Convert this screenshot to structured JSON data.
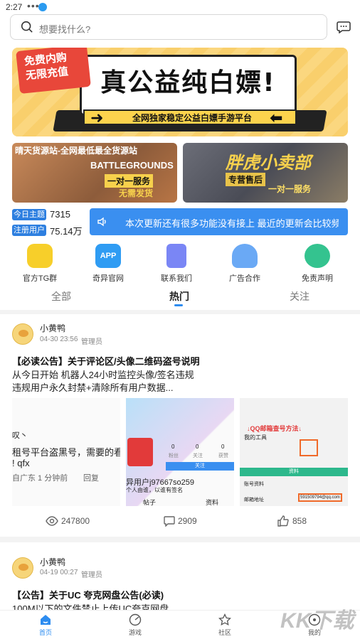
{
  "status": {
    "time": "2:27",
    "dots": "•••"
  },
  "search": {
    "placeholder": "想要找什么?"
  },
  "banner": {
    "badge": "免费内购\n无限充值",
    "headline": "真公益纯白嫖!",
    "subtitle": "全网独家稳定公益白嫖手游平台"
  },
  "small_banners": [
    {
      "line1": "晴天货源站-全网最低最全货源站",
      "line2": "BATTLEGROUNDS",
      "line3": "一对一服务",
      "line4": "无需发货"
    },
    {
      "line1": "",
      "line2": "胖虎小卖部",
      "line3": "专营售后",
      "line4": "一对一服务"
    }
  ],
  "stats": {
    "topics_label": "今日主题",
    "topics_value": "7315",
    "users_label": "注册用户",
    "users_value": "75.14万"
  },
  "notice": {
    "text": "本次更新还有很多功能没有接上 最近的更新会比较频繁"
  },
  "quick_icons": [
    {
      "label": "官方TG群",
      "color": "#f7cf2a"
    },
    {
      "label": "奇异官网",
      "color": "#2f9cf3"
    },
    {
      "label": "联系我们",
      "color": "#7a86f5"
    },
    {
      "label": "广告合作",
      "color": "#6aa9f5"
    },
    {
      "label": "免责声明",
      "color": "#34c38f"
    }
  ],
  "tabs": {
    "all": "全部",
    "hot": "热门",
    "follow": "关注"
  },
  "post1": {
    "user": "小黄鸭",
    "date": "04-30 23:56",
    "role": "管理员",
    "title": "【必读公告】关于评论区/头像二维码盗号说明",
    "body1": "从今日开始 机器人24小时监控头像/签名违规",
    "body2": "违规用户永久封禁+清除所有用户数据...",
    "img1": {
      "l1": "叹丶",
      "l2": "租号平台盗黑号，需要的看",
      "l3": "! qfx",
      "l4": "自广东 1 分钟前",
      "l5": "回复"
    },
    "img2": {
      "l1": "异用户j97667so259",
      "l2": "个人由谁，以谁有签名",
      "tab1": "帖子",
      "tab2": "资料",
      "follow": "关注",
      "s1": "0",
      "s2": "0",
      "s3": "0",
      "k1": "粉丝",
      "k2": "关注",
      "k3": "获赞"
    },
    "img3": {
      "l1": "↓QQ邮箱查号方法↓",
      "l2": "我的工具",
      "l3": "账号资料",
      "l4": "邮箱地址",
      "l5": "591509794@qq.com",
      "l6": "资料"
    },
    "views": "247800",
    "comments": "2909",
    "likes": "858"
  },
  "post2": {
    "user": "小黄鸭",
    "date": "04-19 00:27",
    "role": "管理员",
    "title": "【公告】关于UC 夸克网盘公告(必读)",
    "body1": "100M以下的文件禁止上传UC夸克网盘"
  },
  "nav": [
    {
      "label": "首页"
    },
    {
      "label": "游戏"
    },
    {
      "label": "社区"
    },
    {
      "label": "我的"
    }
  ],
  "watermark": "KK下载"
}
